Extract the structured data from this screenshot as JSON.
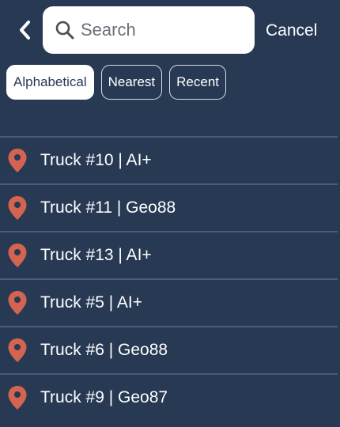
{
  "header": {
    "back_icon": "chevron-left-icon",
    "search": {
      "placeholder": "Search",
      "value": "",
      "icon": "search-icon"
    },
    "cancel_label": "Cancel"
  },
  "filters": [
    {
      "label": "Alphabetical",
      "active": true
    },
    {
      "label": "Nearest",
      "active": false
    },
    {
      "label": "Recent",
      "active": false
    }
  ],
  "items": [
    {
      "label": "Truck #10 | AI+",
      "icon": "map-pin-icon"
    },
    {
      "label": "Truck #11 | Geo88",
      "icon": "map-pin-icon"
    },
    {
      "label": "Truck #13 | AI+",
      "icon": "map-pin-icon"
    },
    {
      "label": "Truck #5 | AI+",
      "icon": "map-pin-icon"
    },
    {
      "label": "Truck #6 | Geo88",
      "icon": "map-pin-icon"
    },
    {
      "label": "Truck #9 | Geo87",
      "icon": "map-pin-icon"
    }
  ],
  "colors": {
    "background": "#283954",
    "pin": "#d4644f",
    "divider": "#4c5c75",
    "text": "#ffffff",
    "chip_active_text": "#283954"
  }
}
